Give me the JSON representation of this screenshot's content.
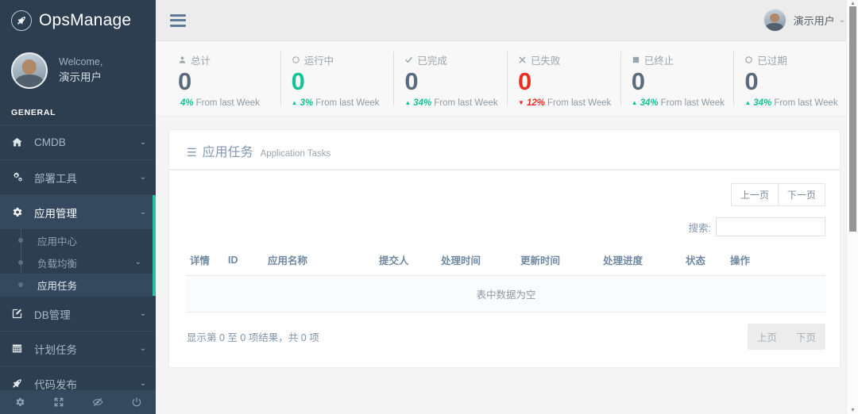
{
  "brand": {
    "name": "OpsManage",
    "logo_icon": "rocket-icon"
  },
  "profile": {
    "welcome_label": "Welcome,",
    "user_name": "演示用户",
    "avatar_icon": "avatar"
  },
  "sidebar": {
    "section_label": "GENERAL",
    "items": [
      {
        "label": "CMDB",
        "icon": "home-icon",
        "caret": "⌄",
        "active": false
      },
      {
        "label": "部署工具",
        "icon": "cogs-icon",
        "caret": "⌄",
        "active": false
      },
      {
        "label": "应用管理",
        "icon": "gear-icon",
        "caret": "⌄",
        "active": true
      },
      {
        "label": "DB管理",
        "icon": "edit-square-icon",
        "caret": "⌄",
        "active": false
      },
      {
        "label": "计划任务",
        "icon": "calendar-icon",
        "caret": "⌄",
        "active": false
      },
      {
        "label": "代码发布",
        "icon": "rocket-icon",
        "caret": "⌄",
        "active": false
      }
    ],
    "submenu": [
      {
        "label": "应用中心",
        "caret": "",
        "active": false
      },
      {
        "label": "负载均衡",
        "caret": "⌄",
        "active": false
      },
      {
        "label": "应用任务",
        "caret": "",
        "active": true
      }
    ],
    "footer_icons": [
      "gear-icon",
      "expand-icon",
      "eye-slash-icon",
      "power-icon"
    ]
  },
  "topbar": {
    "menu_toggle_icon": "hamburger-icon",
    "user_name": "演示用户",
    "user_chevron": "⌄",
    "avatar_icon": "avatar"
  },
  "stats": [
    {
      "label": "总计",
      "icon": "user-icon",
      "value": "0",
      "value_color": "slate",
      "trend": "",
      "percent": "4%",
      "percent_color": "green",
      "note": "From last Week"
    },
    {
      "label": "运行中",
      "icon": "spinner-icon",
      "value": "0",
      "value_color": "green",
      "trend": "▲",
      "percent": "3%",
      "percent_color": "green",
      "note": "From last Week"
    },
    {
      "label": "已完成",
      "icon": "check-icon",
      "value": "0",
      "value_color": "slate",
      "trend": "▲",
      "percent": "34%",
      "percent_color": "green",
      "note": "From last Week"
    },
    {
      "label": "已失败",
      "icon": "times-icon",
      "value": "0",
      "value_color": "red",
      "trend": "▼",
      "percent": "12%",
      "percent_color": "red",
      "note": "From last Week"
    },
    {
      "label": "已终止",
      "icon": "square-icon",
      "value": "0",
      "value_color": "slate",
      "trend": "▲",
      "percent": "34%",
      "percent_color": "green",
      "note": "From last Week"
    },
    {
      "label": "已过期",
      "icon": "circle-icon",
      "value": "0",
      "value_color": "slate",
      "trend": "▲",
      "percent": "34%",
      "percent_color": "green",
      "note": "From last Week"
    }
  ],
  "panel": {
    "icon": "list-icon",
    "title": "应用任务",
    "subtitle": "Application Tasks",
    "pager_top": {
      "prev": "上一页",
      "next": "下一页"
    },
    "search": {
      "label": "搜索:",
      "value": "",
      "placeholder": ""
    },
    "table": {
      "columns": [
        "详情",
        "ID",
        "应用名称",
        "提交人",
        "处理时间",
        "更新时间",
        "处理进度",
        "状态",
        "操作"
      ],
      "empty_message": "表中数据为空",
      "rows": []
    },
    "info_text": "显示第 0 至 0 项结果，共 0 项",
    "pager_bottom": {
      "prev": "上页",
      "next": "下页"
    }
  },
  "colors": {
    "sidebar_bg": "#2c3e50",
    "sidebar_active_bg": "#34495e",
    "accent_green": "#2bc0a1",
    "stat_green": "#13c296",
    "stat_red": "#ee2c24",
    "slate_number": "#5a6b7d",
    "panel_title": "#8096ae"
  }
}
